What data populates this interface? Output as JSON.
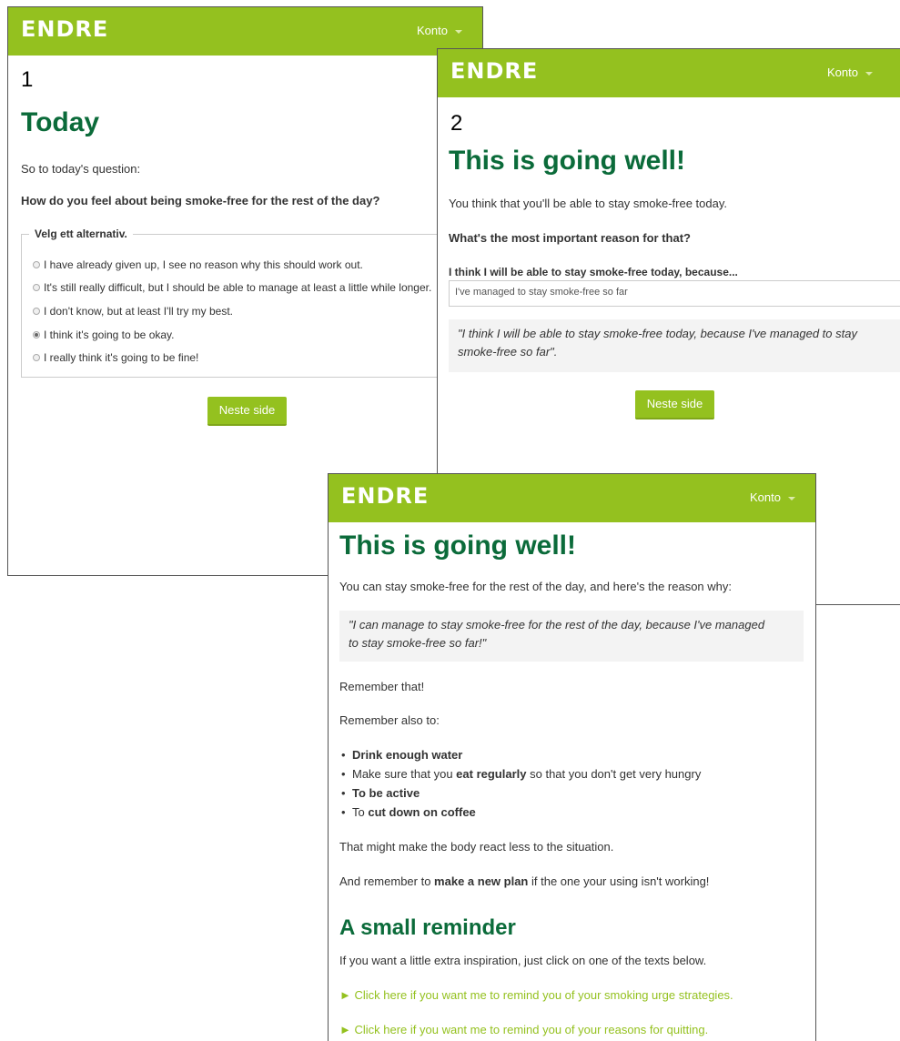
{
  "brand": "ENDRE",
  "account_menu": "Konto",
  "screen1": {
    "step": "1",
    "title": "Today",
    "intro": "So to today's question:",
    "question": "How do you feel about being smoke-free for the rest of the day?",
    "legend": "Velg ett alternativ.",
    "options": [
      {
        "label": "I have already given up, I see no reason why this should work out.",
        "checked": false
      },
      {
        "label": "It's still really difficult, but I should be able to manage at least a little while longer.",
        "checked": false
      },
      {
        "label": "I don't know, but at least I'll try my best.",
        "checked": false
      },
      {
        "label": "I think it's going to be okay.",
        "checked": true
      },
      {
        "label": "I really think it's going to be fine!",
        "checked": false
      }
    ],
    "next_button": "Neste side"
  },
  "screen2": {
    "step": "2",
    "title": "This is going well!",
    "intro": "You think that you'll be able to stay smoke-free today.",
    "question": "What's the most important reason for that?",
    "field_label": "I think I will be able to stay smoke-free today, because...",
    "field_value": "I've managed to stay smoke-free so far",
    "quote_line1": "\"I think I will be able to stay smoke-free today, because I've managed to stay",
    "quote_line2": "smoke-free so far\".",
    "next_button": "Neste side"
  },
  "screen3": {
    "title": "This is going well!",
    "intro": "You can stay smoke-free for the rest of the day, and here's the reason why:",
    "quote_line1": "\"I can manage to stay smoke-free for the rest of the day, because I've managed",
    "quote_line2": "to stay smoke-free so far!\"",
    "remember": "Remember that!",
    "remember_also": "Remember also to:",
    "bullets": [
      {
        "pre": "",
        "bold": "Drink enough water",
        "post": ""
      },
      {
        "pre": "Make sure that you ",
        "bold": "eat regularly",
        "post": " so that you don't get very hungry"
      },
      {
        "pre": "",
        "bold": "To be active",
        "post": ""
      },
      {
        "pre": "To ",
        "bold": "cut down on coffee",
        "post": ""
      }
    ],
    "body_react": "That might make the body react less to the situation.",
    "plan_pre": "And remember to ",
    "plan_bold": "make a new plan",
    "plan_post": " if the one your using isn't working!",
    "reminder_title": "A small reminder",
    "reminder_intro": "If you want a little extra inspiration, just click on one of the texts below.",
    "link1": "► Click here if you want me to remind you of your smoking urge strategies.",
    "link2": "► Click here if you want me to remind you of your reasons for quitting."
  },
  "colors": {
    "navbar": "#94c11f",
    "title_green": "#0b6b3a",
    "link_green": "#94c11f",
    "quote_bg": "#f3f3f3"
  }
}
